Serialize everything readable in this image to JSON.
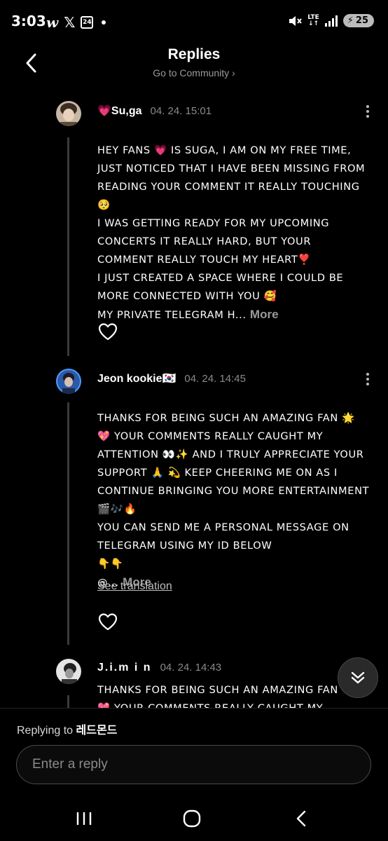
{
  "status_bar": {
    "time": "3:03",
    "left_icons": [
      "w-app-icon",
      "x-app-icon",
      "calendar-icon"
    ],
    "calendar_day": "24",
    "network": "LTE",
    "battery": "25"
  },
  "header": {
    "title": "Replies",
    "subtitle": "Go to Community",
    "subtitle_chevron": "›"
  },
  "comments": [
    {
      "name": "💗Su,ga",
      "time": "04. 24. 15:01",
      "body": "HEY FANS 💗 IS SUGA, I AM ON MY FREE TIME, JUST NOTICED THAT I HAVE BEEN MISSING FROM READING YOUR COMMENT IT REALLY TOUCHING🥺\nI WAS GETTING READY FOR MY UPCOMING CONCERTS IT REALLY HARD, BUT YOUR COMMENT REALLY TOUCH MY HEART❣️\nI JUST CREATED A SPACE WHERE I COULD BE MORE CONNECTED WITH YOU 🥰\nMY PRIVATE TELEGRAM H...",
      "more": "More"
    },
    {
      "name": "Jeon kookie🇰🇷",
      "time": "04. 24. 14:45",
      "body": "THANKS FOR BEING SUCH AN AMAZING FAN 🌟\n💖 YOUR COMMENTS REALLY CAUGHT MY ATTENTION 👀✨ AND I TRULY APPRECIATE YOUR SUPPORT 🙏 💫 KEEP CHEERING ME ON AS I CONTINUE BRINGING YOU MORE ENTERTAINMENT 🎬🎶🔥\nYOU CAN SEND ME A PERSONAL MESSAGE ON TELEGRAM USING MY ID BELOW\n👇👇\n@...",
      "more": "More",
      "see_translation": "See translation"
    },
    {
      "name": "J.i.m i n",
      "time": "04. 24. 14:43",
      "body": "THANKS FOR BEING SUCH AN AMAZING FAN\n💖 YOUR COMMENTS REALLY CAUGHT MY"
    }
  ],
  "reply_box": {
    "replying_label": "Replying to",
    "replying_user": "레드몬드",
    "placeholder": "Enter a reply"
  },
  "colors": {
    "background": "#000000",
    "secondary_text": "#8a8a8a",
    "thread_line": "#3a3a3a"
  }
}
